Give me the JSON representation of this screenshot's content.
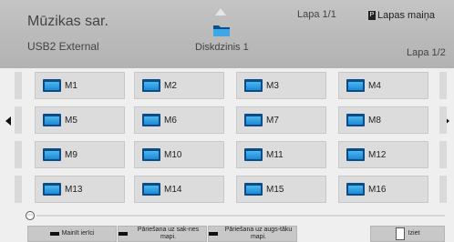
{
  "header": {
    "title": "Mūzikas sar.",
    "device": "USB2 External",
    "disk_label": "Diskdzinis 1",
    "page_top": "Lapa 1/1",
    "page_change": "Lapas maiņa",
    "page_change_key": "P",
    "page_bottom": "Lapa 1/2"
  },
  "folders": [
    "M1",
    "M2",
    "M3",
    "M4",
    "M5",
    "M6",
    "M7",
    "M8",
    "M9",
    "M10",
    "M11",
    "M12",
    "M13",
    "M14",
    "M15",
    "M16"
  ],
  "buttons": {
    "change_device": "Mainīt ierīci",
    "go_root": "Pāriešana uz sak-nes mapi.",
    "go_up": "Pāriešana uz augs-tāku mapi.",
    "exit": "Iziet"
  }
}
